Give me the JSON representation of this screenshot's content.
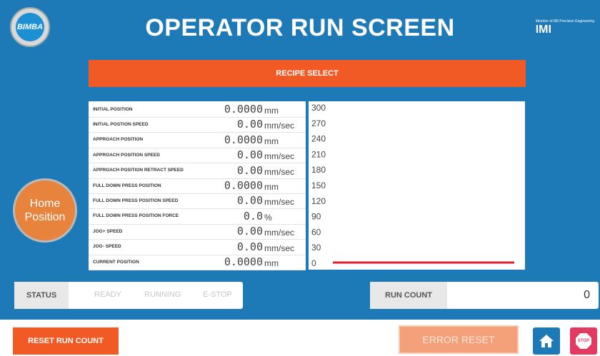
{
  "header": {
    "logo_text": "BIMBA",
    "title": "OPERATOR RUN SCREEN",
    "brand_small": "Member of IMI Precision Engineering",
    "brand": "IMI"
  },
  "recipe_button": "RECIPE SELECT",
  "home_position_button": "Home Position",
  "parameters": [
    {
      "label": "INITIAL POSITION",
      "value": "0.0000",
      "unit": "mm"
    },
    {
      "label": "INITIAL POSTION SPEED",
      "value": "0.00",
      "unit": "mm/sec"
    },
    {
      "label": "APPROACH POSITION",
      "value": "0.0000",
      "unit": "mm"
    },
    {
      "label": "APPROACH POSITION SPEED",
      "value": "0.00",
      "unit": "mm/sec"
    },
    {
      "label": "APPROACH POSITION RETRACT SPEED",
      "value": "0.00",
      "unit": "mm/sec"
    },
    {
      "label": "FULL DOWN PRESS POSITION",
      "value": "0.0000",
      "unit": "mm"
    },
    {
      "label": "FULL DOWN PRESS POSITION SPEED",
      "value": "0.00",
      "unit": "mm/sec"
    },
    {
      "label": "FULL DOWN PRESS POSITION FORCE",
      "value": "0.0",
      "unit": "%"
    },
    {
      "label": "JOG+ SPEED",
      "value": "0.00",
      "unit": "mm/sec"
    },
    {
      "label": "JOG- SPEED",
      "value": "0.00",
      "unit": "mm/sec"
    },
    {
      "label": "CURRENT POSITION",
      "value": "0.0000",
      "unit": "mm"
    }
  ],
  "chart_data": {
    "type": "bar",
    "orientation": "horizontal",
    "ticks": [
      "300",
      "270",
      "240",
      "210",
      "180",
      "150",
      "120",
      "90",
      "60",
      "30",
      "0"
    ],
    "values": [
      0
    ],
    "ylim": [
      0,
      300
    ],
    "bar_color": "#e0202a"
  },
  "status": {
    "label": "STATUS",
    "states": [
      "READY",
      "RUNNING",
      "E-STOP"
    ]
  },
  "run_count": {
    "label": "RUN COUNT",
    "value": "0"
  },
  "buttons": {
    "reset_run_count": "RESET RUN COUNT",
    "error_reset": "ERROR RESET",
    "stop": "STOP"
  },
  "colors": {
    "background": "#1e7ab6",
    "accent": "#f15a24"
  }
}
